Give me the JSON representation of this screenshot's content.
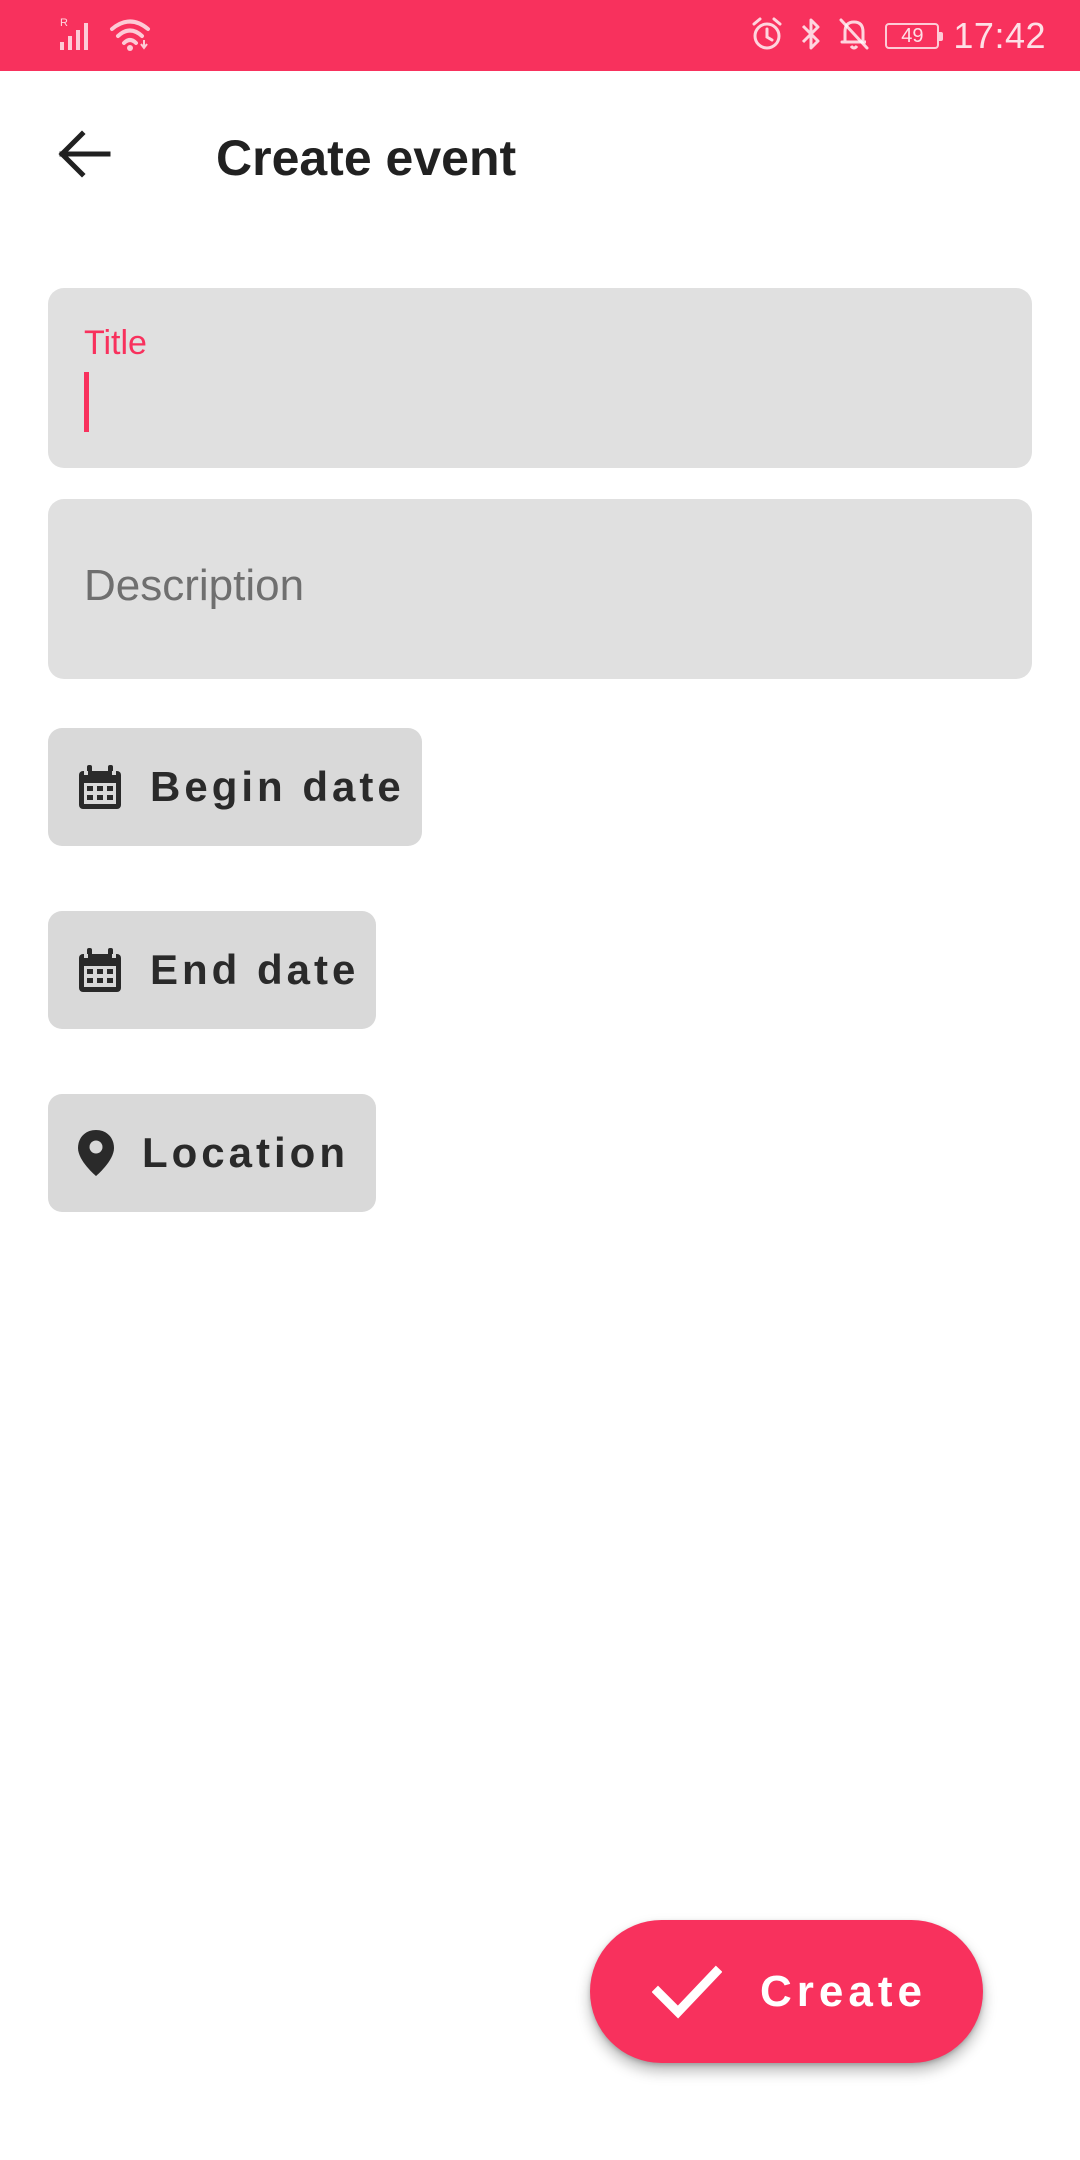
{
  "status_bar": {
    "time": "17:42",
    "battery": "49",
    "network_label": "R",
    "icons": [
      "signal-icon",
      "wifi-icon",
      "alarm-icon",
      "bluetooth-icon",
      "notifications-off-icon",
      "battery-icon"
    ]
  },
  "app_bar": {
    "title": "Create event",
    "back_icon": "arrow-back-icon"
  },
  "form": {
    "title_field": {
      "label": "Title",
      "value": ""
    },
    "description_field": {
      "placeholder": "Description",
      "value": ""
    },
    "begin_date_button": {
      "label": "Begin date",
      "icon": "calendar-icon"
    },
    "end_date_button": {
      "label": "End date",
      "icon": "calendar-icon"
    },
    "location_button": {
      "label": "Location",
      "icon": "location-pin-icon"
    }
  },
  "fab": {
    "label": "Create",
    "icon": "check-icon"
  },
  "colors": {
    "accent": "#f8315d",
    "field_background": "#e0e0e0",
    "chip_background": "#d9d9d9",
    "text_primary": "#212121"
  }
}
